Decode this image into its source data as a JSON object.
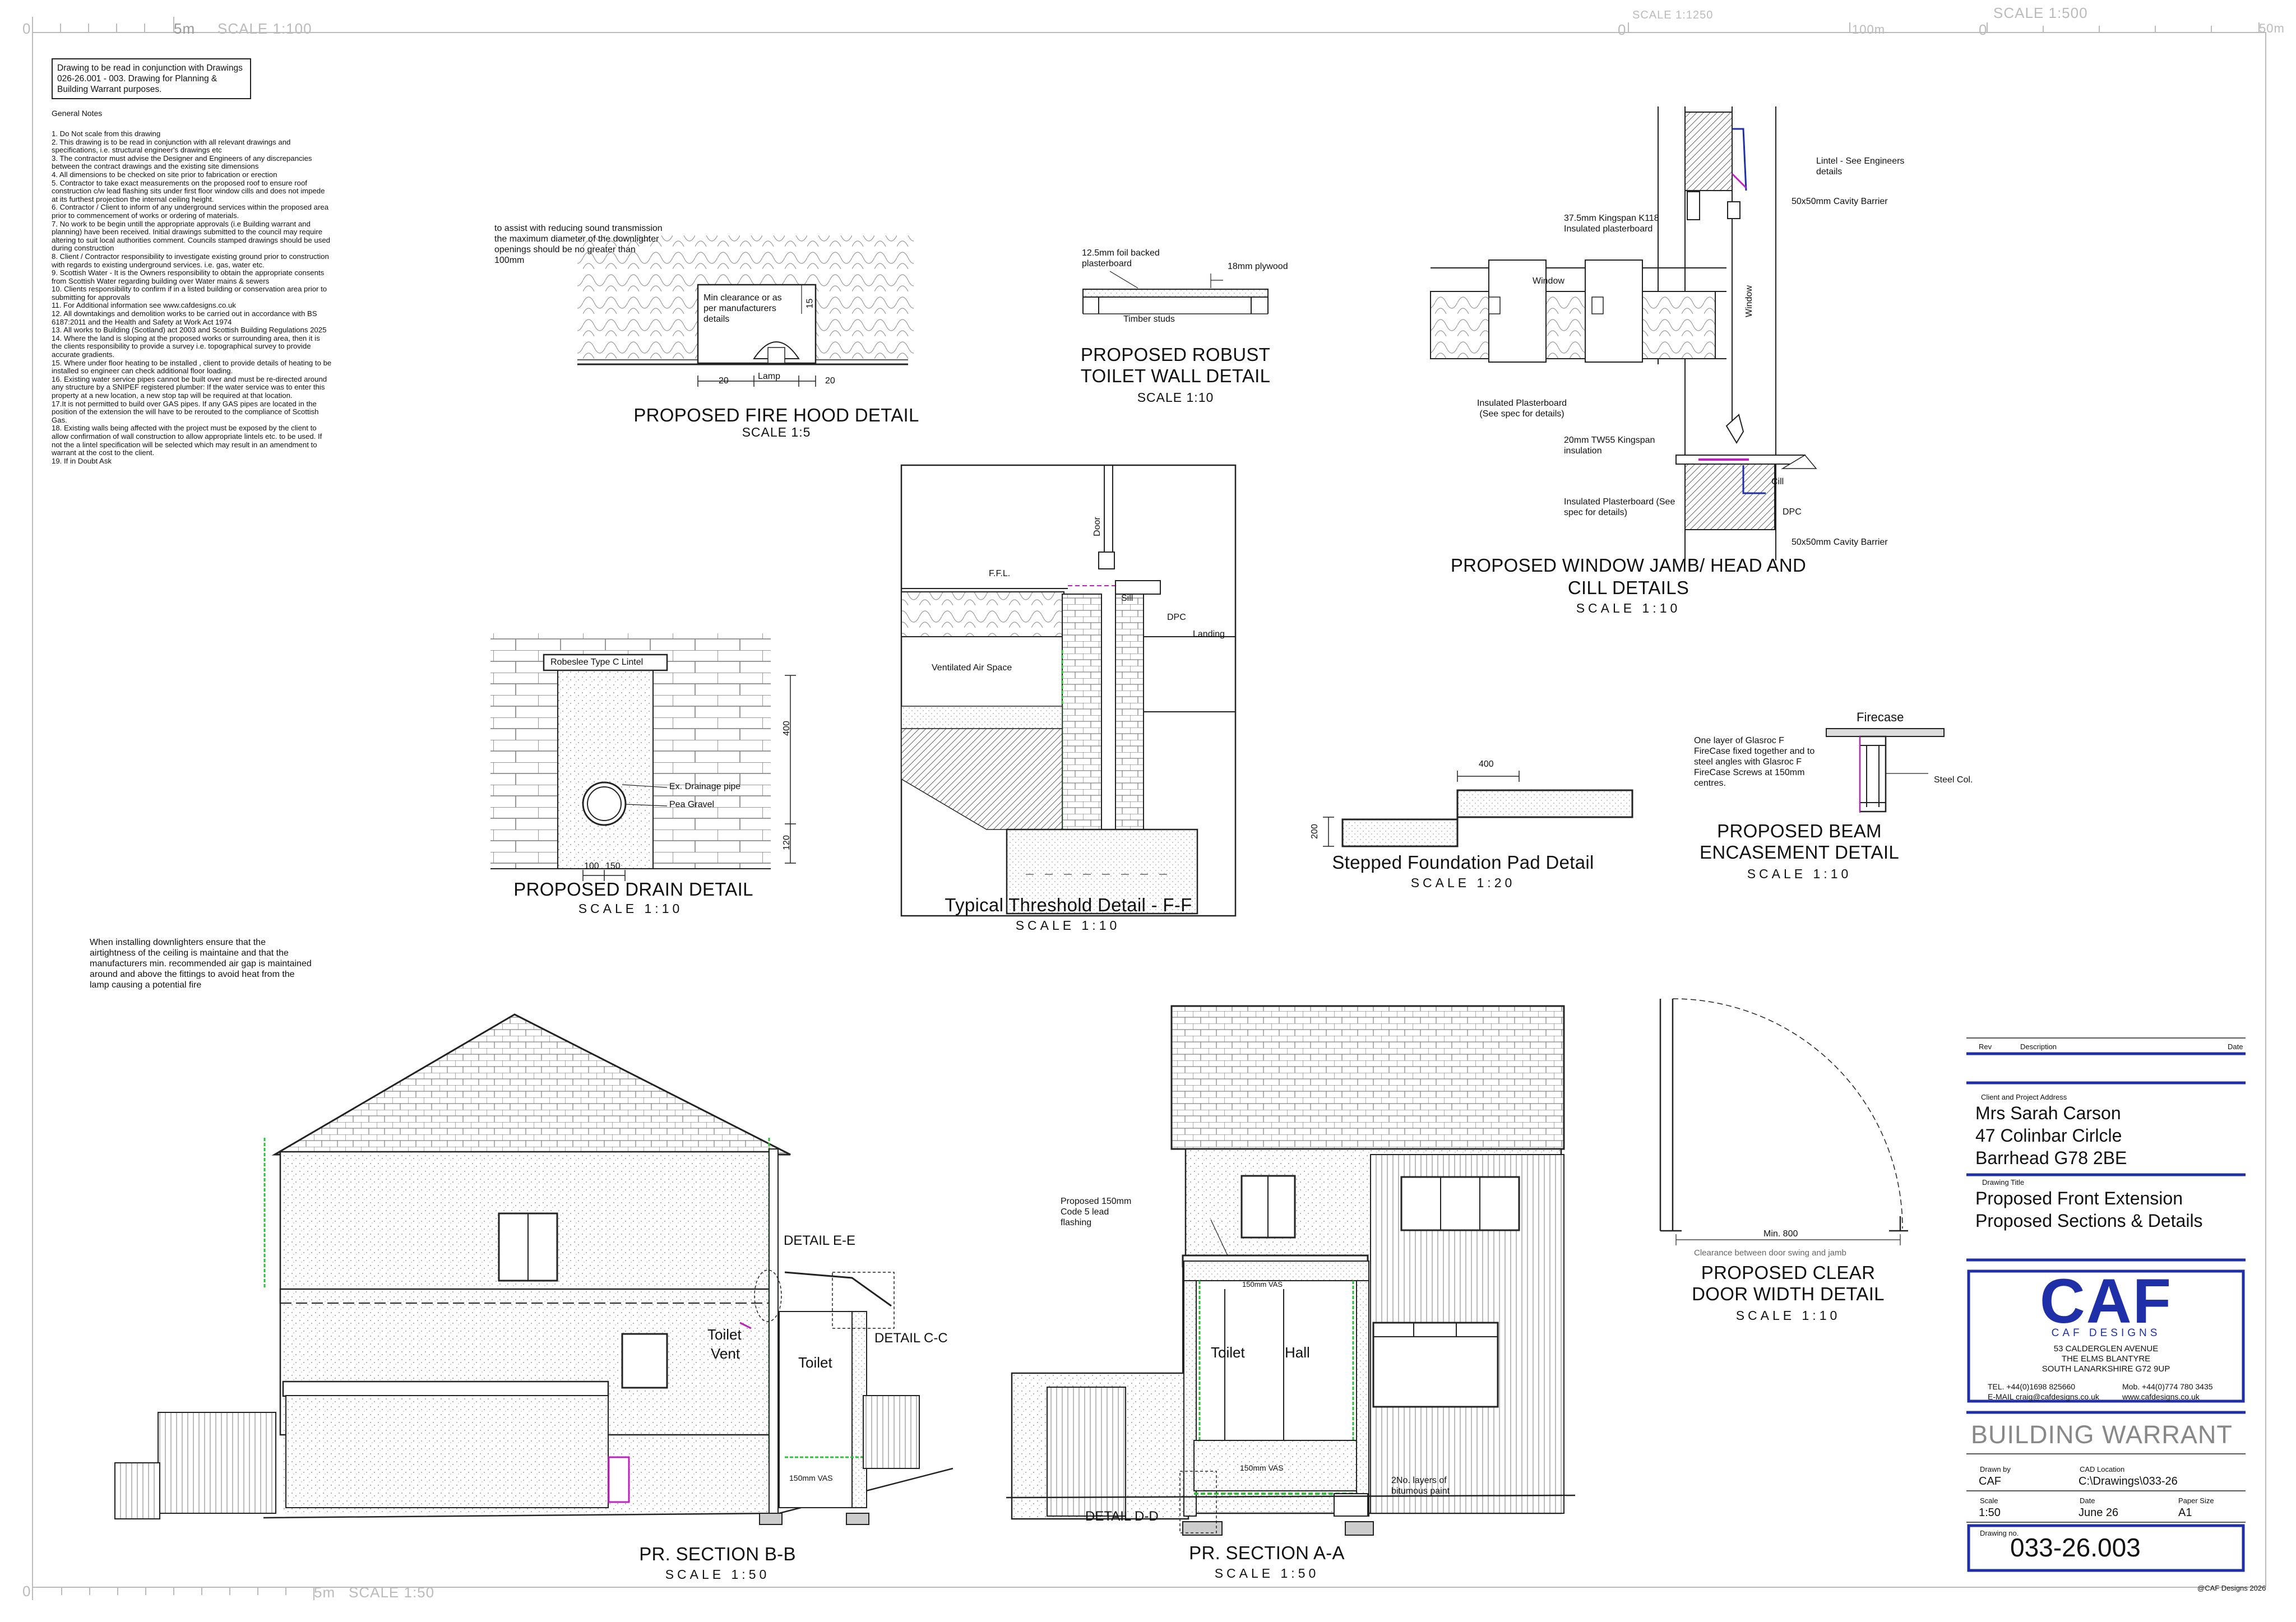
{
  "scale_bars": {
    "top_left_start": "0",
    "top_left_end": "5m",
    "top_left_label": "SCALE 1:100",
    "top_mid_label": "SCALE 1:1250",
    "top_mid_start": "0",
    "top_mid_end": "100m",
    "top_right_label": "SCALE 1:500",
    "top_right_start": "0",
    "top_right_end": "50m",
    "bottom_start": "0",
    "bottom_end": "5m",
    "bottom_label": "SCALE 1:50"
  },
  "notes": {
    "box_text": "Drawing to be read in conjunction with Drawings 026-26.001 - 003. Drawing for Planning & Building Warrant purposes.",
    "heading": "General Notes",
    "items": [
      "1. Do Not scale from this drawing",
      "2. This drawing is to be read in conjunction with all relevant drawings and specifications, i.e. structural engineer's drawings etc",
      "3. The contractor must advise the Designer and Engineers of any discrepancies between the contract drawings and the existing site dimensions",
      "4. All dimensions to be checked on site prior to fabrication or erection",
      "5. Contractor to take exact measurements on the proposed roof to ensure roof construction c/w lead flashing sits under first floor window cills and does not impede at its furthest projection the internal ceiling height.",
      "6. Contractor / Client to inform of any underground services within the proposed area prior to commencement of works or ordering of materials.",
      "7. No work to be begin untill the appropriate approvals (i.e Building warrant and planning) have been received. Initial drawings submitted to the council may require altering to suit local authorities comment. Councils stamped drawings should be used during construction",
      "8. Client / Contractor responsibility to investigate existing ground prior to construction with regards to existing underground services. i.e. gas, water etc.",
      "9. Scottish Water - It is the Owners responsibility to obtain the appropriate consents from Scottish Water regarding building over Water mains & sewers",
      "10. Clients responsibility to confirm if in a listed building or conservation area prior to submitting for approvals",
      "11. For Additional information see www.cafdesigns.co.uk",
      "12. All downtakings and demolition works to be carried out in accordance with BS 6187:2011 and the Health and Safety at Work Act 1974",
      "13.     All works to Building (Scotland) act 2003 and Scottish Building Regulations 2025",
      "14. Where the land is sloping at the proposed works or surrounding area, then it is the clients responsibility to provide a survey i.e. topographical survey to provide accurate gradients.",
      "15. Where under floor heating to be installed , client to provide details of heating to be installed so engineer can check additional floor loading.",
      "16. Existing water service pipes cannot be built over and must be re-directed around any structure by a SNIPEF registered plumber: If the water service was to enter this property at a new location, a new stop tap will be required at that location.",
      "17.It is not permitted to build over GAS pipes. If any GAS pipes are located in the position of the extension the will have to be rerouted to the compliance of Scottish Gas.",
      "18. Existing walls being affected with the project must be exposed by the client to allow confirmation of wall construction to allow appropriate lintels etc. to be used. If not the a lintel specification will be selected which may result in an amendment to warrant at the cost to the client.",
      "19. If in Doubt Ask"
    ]
  },
  "fire_hood": {
    "note": "to assist with reducing sound transmission the maximum diameter of the downlighter openings should be no greater than 100mm",
    "clearance": "Min clearance or as per manufacturers details",
    "dim_15": "15",
    "dim_20a": "20",
    "lamp": "Lamp",
    "dim_20b": "20",
    "title": "PROPOSED FIRE HOOD DETAIL",
    "scale": "SCALE 1:5"
  },
  "toilet_wall": {
    "foil": "12.5mm foil backed plasterboard",
    "plywood": "18mm plywood",
    "studs": "Timber studs",
    "title1": "PROPOSED ROBUST",
    "title2": "TOILET WALL DETAIL",
    "scale": "SCALE 1:10"
  },
  "window_jamb": {
    "lintel": "Lintel - See Engineers details",
    "cavity1": "50x50mm Cavity Barrier",
    "kingspan1": "37.5mm Kingspan K118 Insulated plasterboard",
    "window_h": "Window",
    "window_v": "Window",
    "plasterboard1": "Insulated Plasterboard (See spec for details)",
    "kingspan2": "20mm TW55 Kingspan insulation",
    "cill": "Cill",
    "plasterboard2": "Insulated Plasterboard (See spec for details)",
    "dpc": "DPC",
    "cavity2": "50x50mm Cavity Barrier",
    "title1": "PROPOSED WINDOW JAMB/ HEAD AND",
    "title2": "CILL DETAILS",
    "scale": "SCALE 1:10"
  },
  "threshold": {
    "door": "Door",
    "ffl": "F.F.L.",
    "sill": "Sill",
    "dpc": "DPC",
    "landing": "Landing",
    "air": "Ventilated Air Space",
    "title": "Typical Threshold Detail - F-F",
    "scale": "SCALE 1:10"
  },
  "drain": {
    "lintel": "Robeslee Type C Lintel",
    "dim_400": "400",
    "pipe": "Ex. Drainage pipe",
    "gravel": "Pea Gravel",
    "dim_120": "120",
    "dim_100": "100",
    "dim_150": "150",
    "title": "PROPOSED DRAIN DETAIL",
    "scale": "SCALE 1:10"
  },
  "stepped": {
    "dim_400": "400",
    "dim_200": "200",
    "title": "Stepped Foundation Pad Detail",
    "scale": "SCALE 1:20"
  },
  "beam": {
    "firecase": "Firecase",
    "note": "One layer of Glasroc F FireCase fixed together and to steel angles with Glasroc F FireCase Screws at 150mm centres.",
    "steel": "Steel Col.",
    "title1": "PROPOSED BEAM",
    "title2": "ENCASEMENT DETAIL",
    "scale": "SCALE 1:10"
  },
  "downlighter_note": "When installing downlighters ensure that the airtightness of the ceiling is maintaine and that the manufacturers min. recommended air gap is maintained around and above the fittings to avoid heat from the lamp causing a potential fire",
  "section_bb": {
    "detail_e": "DETAIL E-E",
    "detail_c": "DETAIL C-C",
    "toilet_vent1": "Toilet",
    "toilet_vent2": "Vent",
    "toilet": "Toilet",
    "vas": "150mm VAS",
    "title": "PR. SECTION B-B",
    "scale": "SCALE 1:50"
  },
  "section_aa": {
    "flashing": "Proposed 150mm Code 5 lead flashing",
    "vas_top": "150mm VAS",
    "toilet": "Toilet",
    "hall": "Hall",
    "vas_bottom": "150mm VAS",
    "bitumen": "2No. layers of bitumous paint",
    "detail_d": "DETAIL D-D",
    "title": "PR. SECTION A-A",
    "scale": "SCALE 1:50"
  },
  "door_width": {
    "min": "Min. 800",
    "clearance": "Clearance between door swing and jamb",
    "title1": "PROPOSED CLEAR",
    "title2": "DOOR WIDTH DETAIL",
    "scale": "SCALE 1:10"
  },
  "title_block": {
    "rev": "Rev",
    "description": "Description",
    "date": "Date",
    "client_label": "Client and Project Address",
    "client_line1": "Mrs Sarah Carson",
    "client_line2": "47 Colinbar Cirlcle",
    "client_line3": "Barrhead G78 2BE",
    "drawing_title_label": "Drawing Title",
    "drawing_title1": "Proposed Front Extension",
    "drawing_title2": "Proposed Sections & Details",
    "logo": "CAF",
    "logo_sub": "CAF DESIGNS",
    "addr1": "53 CALDERGLEN AVENUE",
    "addr2": "THE ELMS BLANTYRE",
    "addr3": "SOUTH LANARKSHIRE G72 9UP",
    "tel": "TEL. +44(0)1698 825660",
    "mob": "Mob. +44(0)774 780 3435",
    "email": "E-MAIL  craig@cafdesigns.co.uk",
    "web": "www.cafdesigns.co.uk",
    "status": "BUILDING WARRANT",
    "drawn_by_label": "Drawn by",
    "drawn_by": "CAF",
    "cad_label": "CAD Location",
    "cad": "C:\\Drawings\\033-26",
    "scale_label": "Scale",
    "scale": "1:50",
    "date_label": "Date",
    "date_value": "June 26",
    "paper_label": "Paper Size",
    "paper": "A1",
    "drawing_no_label": "Drawing no.",
    "drawing_no": "033-26.003",
    "copyright": "@CAF Designs 2026"
  },
  "colors": {
    "accent_blue": "#1f2fa8",
    "insulation_green": "#2fbf3a",
    "magenta": "#c020c0"
  }
}
